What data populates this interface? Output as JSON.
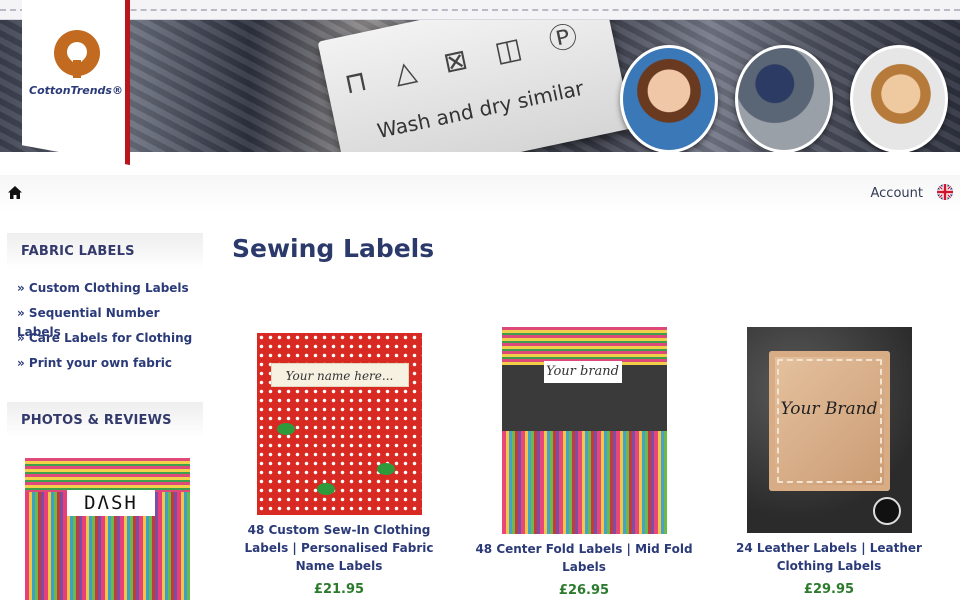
{
  "header": {
    "brand": "CottonTrends®",
    "banner_tag_text": "Wash and dry similar",
    "banner_tag_symbols": "⊓ △ ⊠ ◫ Ⓟ"
  },
  "nav": {
    "home_icon": "home-icon",
    "account_label": "Account",
    "language_icon": "uk-flag-icon"
  },
  "sidebar": {
    "fabric_labels_title": "FABRIC LABELS",
    "items": [
      {
        "label": "» Custom Clothing Labels"
      },
      {
        "label": "» Sequential Number Labels"
      },
      {
        "label": "» Care Labels for Clothing"
      },
      {
        "label": "» Print your own fabric"
      }
    ],
    "photos_reviews_title": "PHOTOS & REVIEWS",
    "review_photo_label": "DΛSH"
  },
  "main": {
    "title": "Sewing Labels",
    "products": [
      {
        "name": "48 Custom Sew-In Clothing Labels | Personalised Fabric Name Labels",
        "price": "£21.95",
        "image_text": "Your name here..."
      },
      {
        "name": "48 Center Fold Labels | Mid Fold Labels",
        "price": "£26.95",
        "image_text": "Your brand"
      },
      {
        "name": "24 Leather Labels | Leather Clothing Labels",
        "price": "£29.95",
        "image_text": "Your Brand"
      }
    ]
  }
}
